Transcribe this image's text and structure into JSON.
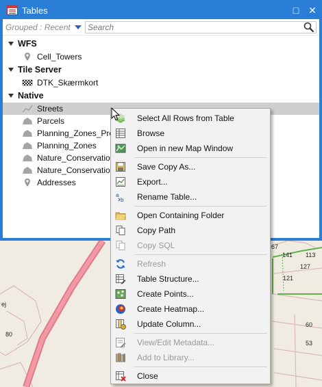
{
  "window": {
    "title": "Tables",
    "controls": {
      "maximize": "□",
      "close": "✕"
    }
  },
  "toolbar": {
    "group_by_label": "Grouped : Recent",
    "search_placeholder": "Search"
  },
  "tree": {
    "groups": [
      {
        "name": "WFS",
        "items": [
          {
            "label": "Cell_Towers",
            "icon": "point-marker-icon"
          }
        ]
      },
      {
        "name": "Tile Server",
        "items": [
          {
            "label": "DTK_Skærmkort",
            "icon": "tile-layer-icon"
          }
        ]
      },
      {
        "name": "Native",
        "items": [
          {
            "label": "Streets",
            "icon": "line-layer-icon",
            "selected": true
          },
          {
            "label": "Parcels",
            "icon": "area-layer-icon"
          },
          {
            "label": "Planning_Zones_Pro",
            "icon": "area-layer-icon"
          },
          {
            "label": "Planning_Zones",
            "icon": "area-layer-icon"
          },
          {
            "label": "Nature_Conservation",
            "icon": "area-layer-icon"
          },
          {
            "label": "Nature_Conservation",
            "icon": "area-layer-icon"
          },
          {
            "label": "Addresses",
            "icon": "point-marker-icon"
          }
        ]
      }
    ]
  },
  "context_menu": {
    "items": [
      {
        "label": "Select All Rows from Table",
        "icon": "select-rows-icon",
        "enabled": true
      },
      {
        "label": "Browse",
        "icon": "browse-table-icon",
        "enabled": true
      },
      {
        "label": "Open in new Map Window",
        "icon": "map-window-icon",
        "enabled": true
      },
      {
        "label": "Save Copy As...",
        "icon": "save-icon",
        "enabled": true
      },
      {
        "label": "Export...",
        "icon": "export-icon",
        "enabled": true
      },
      {
        "label": "Rename Table...",
        "icon": "rename-icon",
        "enabled": true
      },
      {
        "label": "Open Containing Folder",
        "icon": "folder-icon",
        "enabled": true
      },
      {
        "label": "Copy Path",
        "icon": "copy-icon",
        "enabled": true
      },
      {
        "label": "Copy SQL",
        "icon": "copy-icon",
        "enabled": false
      },
      {
        "label": "Refresh",
        "icon": "refresh-icon",
        "enabled": false
      },
      {
        "label": "Table Structure...",
        "icon": "table-structure-icon",
        "enabled": true
      },
      {
        "label": "Create Points...",
        "icon": "create-points-icon",
        "enabled": true
      },
      {
        "label": "Create Heatmap...",
        "icon": "heatmap-icon",
        "enabled": true
      },
      {
        "label": "Update Column...",
        "icon": "update-column-icon",
        "enabled": true
      },
      {
        "label": "View/Edit Metadata...",
        "icon": "metadata-icon",
        "enabled": false
      },
      {
        "label": "Add to Library...",
        "icon": "library-icon",
        "enabled": false
      },
      {
        "label": "Close",
        "icon": "close-table-icon",
        "enabled": true
      }
    ]
  },
  "map": {
    "labels": [
      "ej",
      "80",
      "67",
      "141",
      "113",
      "127",
      "121",
      "60",
      "53"
    ]
  }
}
